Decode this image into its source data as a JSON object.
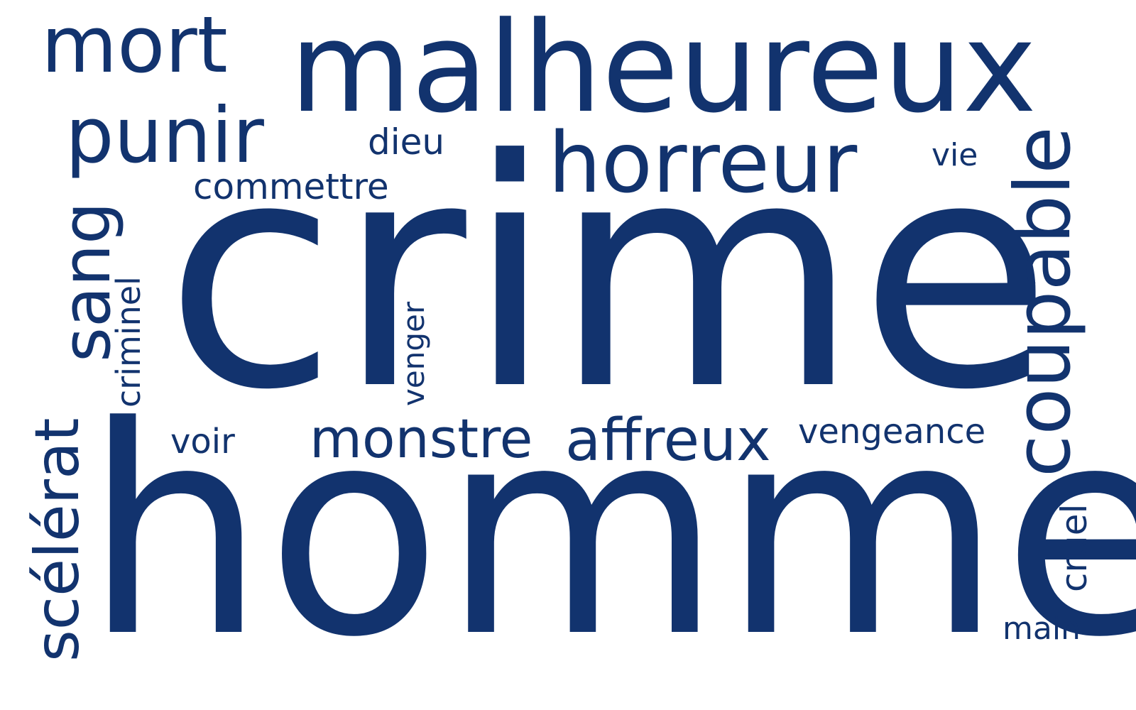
{
  "word_color": "#12336e",
  "words": {
    "crime": "crime",
    "homme": "homme",
    "malheureux": "malheureux",
    "mort": "mort",
    "punir": "punir",
    "horreur": "horreur",
    "dieu": "dieu",
    "commettre": "commettre",
    "vie": "vie",
    "coupable": "coupable",
    "sang": "sang",
    "criminel": "criminel",
    "venger": "venger",
    "voir": "voir",
    "monstre": "monstre",
    "affreux": "affreux",
    "vengeance": "vengeance",
    "scelerat": "scélérat",
    "cruel": "cruel",
    "main": "main"
  }
}
